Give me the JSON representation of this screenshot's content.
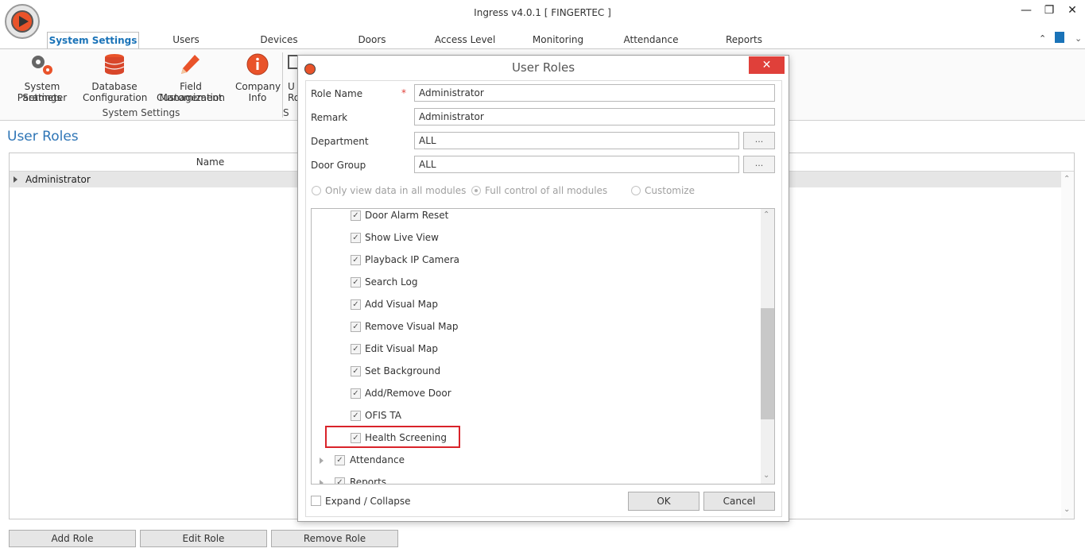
{
  "window": {
    "title": "Ingress v4.0.1 [ FINGERTEC ]",
    "controls": {
      "minimize": "—",
      "restore": "❐",
      "close": "✕"
    }
  },
  "menu_tabs": [
    "System Settings",
    "Users",
    "Devices",
    "Doors",
    "Access Level",
    "Monitoring",
    "Attendance",
    "Reports"
  ],
  "ribbon": {
    "items": [
      {
        "line1": "System Parameter",
        "line2": "Settings",
        "icon": "gears-icon"
      },
      {
        "line1": "Database",
        "line2": "Configuration",
        "icon": "database-icon"
      },
      {
        "line1": "Field Customization",
        "line2": "Management",
        "icon": "pencil-icon"
      },
      {
        "line1": "Company",
        "line2": "Info",
        "icon": "info-icon"
      },
      {
        "line1": "U",
        "line2": "Ro",
        "icon": "user-roles-icon"
      }
    ],
    "group_label": "System Settings",
    "partial_group_label": "S"
  },
  "panel": {
    "title": "User Roles",
    "grid": {
      "column_name": "Name",
      "rows": [
        "Administrator"
      ]
    },
    "buttons": {
      "add": "Add Role",
      "edit": "Edit Role",
      "remove": "Remove Role"
    }
  },
  "dialog": {
    "title": "User Roles",
    "close": "✕",
    "fields": {
      "role_name_label": "Role Name",
      "role_name_value": "Administrator",
      "required_marker": "*",
      "remark_label": "Remark",
      "remark_value": "Administrator",
      "department_label": "Department",
      "department_value": "ALL",
      "door_group_label": "Door Group",
      "door_group_value": "ALL",
      "browse_label": "..."
    },
    "radios": [
      {
        "label": "Only view data in all modules",
        "selected": false
      },
      {
        "label": "Full control of all modules",
        "selected": true
      },
      {
        "label": "Customize",
        "selected": false
      }
    ],
    "tree_items": [
      "Door Alarm Reset",
      "Show Live View",
      "Playback IP Camera",
      "Search Log",
      "Add Visual Map",
      "Remove Visual Map",
      "Edit Visual Map",
      "Set Background",
      "Add/Remove Door",
      "OFIS TA",
      "Health Screening"
    ],
    "tree_parents": [
      "Attendance",
      "Reports"
    ],
    "check_glyph": "✓",
    "expand_collapse_label": "Expand / Collapse",
    "ok_label": "OK",
    "cancel_label": "Cancel"
  },
  "colors": {
    "accent": "#2e75b6",
    "close_red": "#e0403a",
    "highlight": "#d9232a"
  }
}
